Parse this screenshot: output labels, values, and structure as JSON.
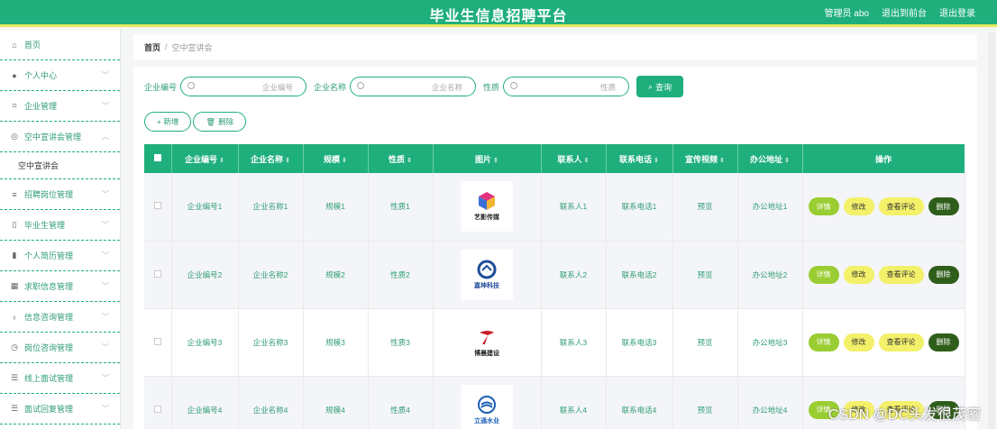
{
  "header": {
    "title": "毕业生信息招聘平台",
    "admin": "管理员 abo",
    "to_front": "退出到前台",
    "logout": "退出登录"
  },
  "sidebar": {
    "items": [
      {
        "label": "首页",
        "icon": "home-icon",
        "chev": ""
      },
      {
        "label": "个人中心",
        "icon": "user-icon",
        "chev": "﹀"
      },
      {
        "label": "企业管理",
        "icon": "crop-icon",
        "chev": "﹀"
      },
      {
        "label": "空中宣讲会管理",
        "icon": "globe-icon",
        "chev": "︿"
      },
      {
        "label": "招聘岗位管理",
        "icon": "sliders-icon",
        "chev": "﹀"
      },
      {
        "label": "毕业生管理",
        "icon": "mic-icon",
        "chev": "﹀"
      },
      {
        "label": "个人简历管理",
        "icon": "chart-icon",
        "chev": "﹀"
      },
      {
        "label": "求职信息管理",
        "icon": "grid-icon",
        "chev": "﹀"
      },
      {
        "label": "信息咨询管理",
        "icon": "mic-icon",
        "chev": "﹀"
      },
      {
        "label": "岗位咨询管理",
        "icon": "clock-icon",
        "chev": "﹀"
      },
      {
        "label": "线上面试管理",
        "icon": "list-icon",
        "chev": "﹀"
      },
      {
        "label": "面试回复管理",
        "icon": "list-icon",
        "chev": "﹀"
      }
    ],
    "sub_active": "空中宣讲会"
  },
  "breadcrumb": {
    "home": "首页",
    "sep": "/",
    "current": "空中宣讲会"
  },
  "search": {
    "label1": "企业编号",
    "ph1": "企业编号",
    "label2": "企业名称",
    "ph2": "企业名称",
    "label3": "性质",
    "ph3": "性质",
    "query": "查询"
  },
  "actions": {
    "add": "+ 新增",
    "delete": "删除"
  },
  "table": {
    "headers": [
      "企业编号",
      "企业名称",
      "规模",
      "性质",
      "图片",
      "联系人",
      "联系电话",
      "宣传视频",
      "办公地址",
      "操作"
    ],
    "rows": [
      {
        "no": "企业编号1",
        "name": "企业名称1",
        "scale": "规模1",
        "nature": "性质1",
        "img_caption": "艺影传媒",
        "contact": "联系人1",
        "phone": "联系电话1",
        "video": "预览",
        "addr": "办公地址1"
      },
      {
        "no": "企业编号2",
        "name": "企业名称2",
        "scale": "规模2",
        "nature": "性质2",
        "img_caption": "嘉坤科技",
        "contact": "联系人2",
        "phone": "联系电话2",
        "video": "预览",
        "addr": "办公地址2"
      },
      {
        "no": "企业编号3",
        "name": "企业名称3",
        "scale": "规模3",
        "nature": "性质3",
        "img_caption": "博晨建设",
        "contact": "联系人3",
        "phone": "联系电话3",
        "video": "预览",
        "addr": "办公地址3"
      },
      {
        "no": "企业编号4",
        "name": "企业名称4",
        "scale": "规模4",
        "nature": "性质4",
        "img_caption": "立通水业",
        "contact": "联系人4",
        "phone": "联系电话4",
        "video": "预览",
        "addr": "办公地址4"
      }
    ],
    "ops": {
      "detail": "详情",
      "edit": "修改",
      "review": "查看评论",
      "del": "删除"
    }
  },
  "watermark": "CSDN @DC头发很茂密",
  "colors": {
    "primary": "#1faf7c",
    "accent_bar": "#e8ea5c",
    "detail": "#9acd32",
    "edit": "#f3f06a",
    "delete": "#2f5e1a"
  }
}
